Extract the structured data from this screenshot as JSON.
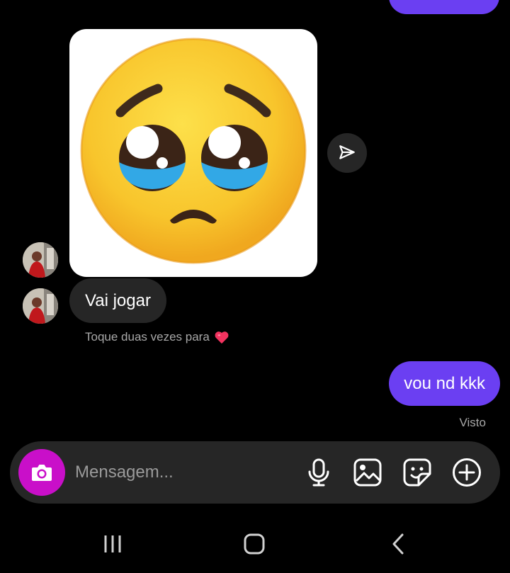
{
  "conversation": {
    "received_message": "Vai jogar",
    "double_tap_hint": "Toque duas vezes para",
    "sent_message": "vou nd kkk",
    "seen_status": "Visto"
  },
  "sticker": {
    "icon": "pleading-face-emoji"
  },
  "composer": {
    "placeholder": "Mensagem..."
  },
  "colors": {
    "background": "#000000",
    "received_bubble": "#262626",
    "sent_bubble": "#6b3ff2",
    "camera_button": "#c90fc9",
    "hint_text": "#a8a8a8"
  }
}
